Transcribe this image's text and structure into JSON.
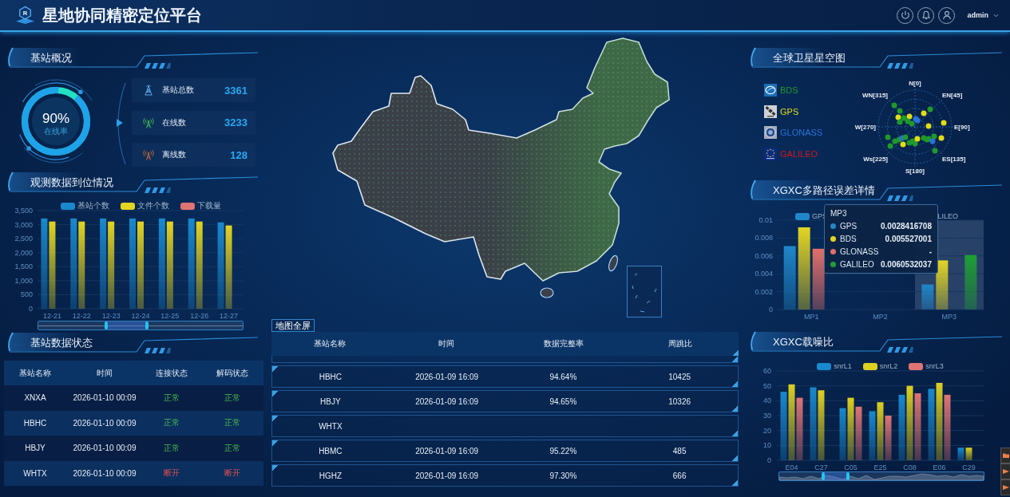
{
  "header": {
    "logo_letter": "R",
    "title": "星地协同精密定位平台",
    "user": "admin"
  },
  "overview": {
    "title": "基站概况",
    "gauge": {
      "value": "90%",
      "label": "在线率",
      "level": 0.9
    },
    "stats": [
      {
        "kind": "total",
        "label": "基站总数",
        "value": "3361"
      },
      {
        "kind": "online",
        "label": "在线数",
        "value": "3233"
      },
      {
        "kind": "offline",
        "label": "离线数",
        "value": "128"
      }
    ]
  },
  "arrival": {
    "title": "观测数据到位情况",
    "chart_data": {
      "type": "bar",
      "categories": [
        "12-21",
        "12-22",
        "12-23",
        "12-24",
        "12-25",
        "12-26",
        "12-27"
      ],
      "series": [
        {
          "name": "基站个数",
          "color": "#1a88cc",
          "values": [
            3220,
            3220,
            3220,
            3220,
            3220,
            3220,
            3080
          ]
        },
        {
          "name": "文件个数",
          "color": "#e2d420",
          "values": [
            3110,
            3110,
            3110,
            3110,
            3110,
            3110,
            2970
          ]
        },
        {
          "name": "下载量",
          "color": "#e07474",
          "values": [
            null,
            null,
            null,
            null,
            null,
            null,
            null
          ]
        }
      ],
      "ylim": [
        0,
        3500
      ],
      "yticks": [
        0,
        500,
        {
          "value": 1000,
          "label": "1,000"
        },
        {
          "value": 1500,
          "label": "1,500"
        },
        {
          "value": 2000,
          "label": "2,000"
        },
        {
          "value": 2500,
          "label": "2,500"
        },
        {
          "value": 3000,
          "label": "3,000"
        },
        {
          "value": 3500,
          "label": "3,500"
        }
      ],
      "grid": true,
      "legend": "top"
    },
    "zoom_slider": {
      "handles": [
        {
          "level": 0.333
        },
        {
          "level": 0.531
        }
      ]
    }
  },
  "station_status": {
    "title": "基站数据状态",
    "columns": [
      "基站名称",
      "时间",
      "连接状态",
      "解码状态"
    ],
    "rows": [
      {
        "name": "XNXA",
        "time": "2026-01-10 00:09",
        "connection": {
          "text": "正常",
          "ok": true
        },
        "decode": {
          "text": "正常",
          "ok": true
        }
      },
      {
        "name": "HBHC",
        "time": "2026-01-10 00:09",
        "connection": {
          "text": "正常",
          "ok": true
        },
        "decode": {
          "text": "正常",
          "ok": true
        }
      },
      {
        "name": "HBJY",
        "time": "2026-01-10 00:09",
        "connection": {
          "text": "正常",
          "ok": true
        },
        "decode": {
          "text": "正常",
          "ok": true
        }
      },
      {
        "name": "WHTX",
        "time": "2026-01-10 00:09",
        "connection": {
          "text": "断开",
          "ok": false
        },
        "decode": {
          "text": "断开",
          "ok": false
        }
      }
    ]
  },
  "map": {
    "fullscreen_button": "地图全屏"
  },
  "map_table": {
    "columns": [
      "基站名称",
      "时间",
      "数据完整率",
      "周跳比"
    ],
    "rows": [
      {
        "name": "HBHC",
        "time": "2026-01-09 16:09",
        "completeness": "94.64%",
        "cycle_slip_ratio": "10425"
      },
      {
        "name": "HBJY",
        "time": "2026-01-09 16:09",
        "completeness": "94.65%",
        "cycle_slip_ratio": "10326"
      },
      {
        "name": "WHTX"
      },
      {
        "name": "HBMC",
        "time": "2026-01-09 16:09",
        "completeness": "95.22%",
        "cycle_slip_ratio": "485"
      },
      {
        "name": "HGHZ",
        "time": "2026-01-09 16:09",
        "completeness": "97.30%",
        "cycle_slip_ratio": "666"
      }
    ]
  },
  "sky": {
    "title": "全球卫星星空图",
    "systems": [
      {
        "name": "BDS",
        "kind": "globe",
        "color": "#1f9a2a"
      },
      {
        "name": "GPS",
        "kind": "satellite",
        "color": "#e2dc16"
      },
      {
        "name": "GLONASS",
        "kind": "emblem",
        "color": "#2a72d8"
      },
      {
        "name": "GALILEO",
        "kind": "stars",
        "color": "#d0161c"
      }
    ],
    "directions": [
      "N[0]",
      "WN[315]",
      "EN[45]",
      "W[270]",
      "E[90]",
      "Ws[225]",
      "ES[135]",
      "S[180]"
    ]
  },
  "multipath": {
    "title": "XGXC多路径误差详情",
    "legend": [
      {
        "label": "GPS",
        "color": "#1f87c9"
      },
      {
        "label": "LILEO"
      }
    ],
    "axis_pointer": [
      false,
      false,
      true
    ],
    "chart_data": {
      "type": "bar",
      "categories": [
        "MP1",
        "MP2",
        "MP3"
      ],
      "series": [
        {
          "name": "GPS",
          "color": "#1f87c9",
          "values": [
            0.0071,
            null,
            0.0028
          ]
        },
        {
          "name": "BDS",
          "color": "#e3d524",
          "values": [
            0.0092,
            null,
            0.0055
          ]
        },
        {
          "name": "GLONASS",
          "color": "#e0706a",
          "values": [
            0.0068,
            null,
            null
          ]
        },
        {
          "name": "GALILEO",
          "color": "#1f9e34",
          "values": [
            null,
            null,
            0.0061
          ]
        }
      ],
      "ylim": [
        0,
        0.01
      ],
      "yticks": [
        0,
        0.002,
        0.004,
        0.006,
        0.008,
        0.01
      ],
      "grid": true,
      "legend": "top"
    },
    "tooltip": {
      "title": "MP3",
      "rows": [
        {
          "value": "0.0028416708"
        },
        {
          "value": "0.005527001"
        },
        {
          "value": "-"
        },
        {
          "value": "0.0060532037"
        }
      ]
    }
  },
  "snr": {
    "title": "XGXC载噪比",
    "chart_data": {
      "type": "bar",
      "categories": [
        "E04",
        "C27",
        "C05",
        "E25",
        "C08",
        "E06",
        "C29"
      ],
      "series": [
        {
          "name": "snrL1",
          "color": "#1a88cc",
          "values": [
            46,
            49,
            35,
            33,
            44,
            48,
            8.5
          ]
        },
        {
          "name": "snrL2",
          "color": "#ddd020",
          "values": [
            51,
            47,
            42,
            39,
            50,
            52,
            8.5
          ]
        },
        {
          "name": "snrL3",
          "color": "#e07474",
          "values": [
            42,
            null,
            36,
            30,
            45,
            44,
            null
          ]
        }
      ],
      "ylim": [
        0,
        60
      ],
      "yticks": [
        0,
        10,
        20,
        30,
        40,
        50,
        60
      ],
      "grid": true,
      "legend": "top"
    },
    "zoom_slider": {
      "handles": [
        {
          "level": 0.213
        },
        {
          "level": 0.337
        }
      ]
    }
  }
}
